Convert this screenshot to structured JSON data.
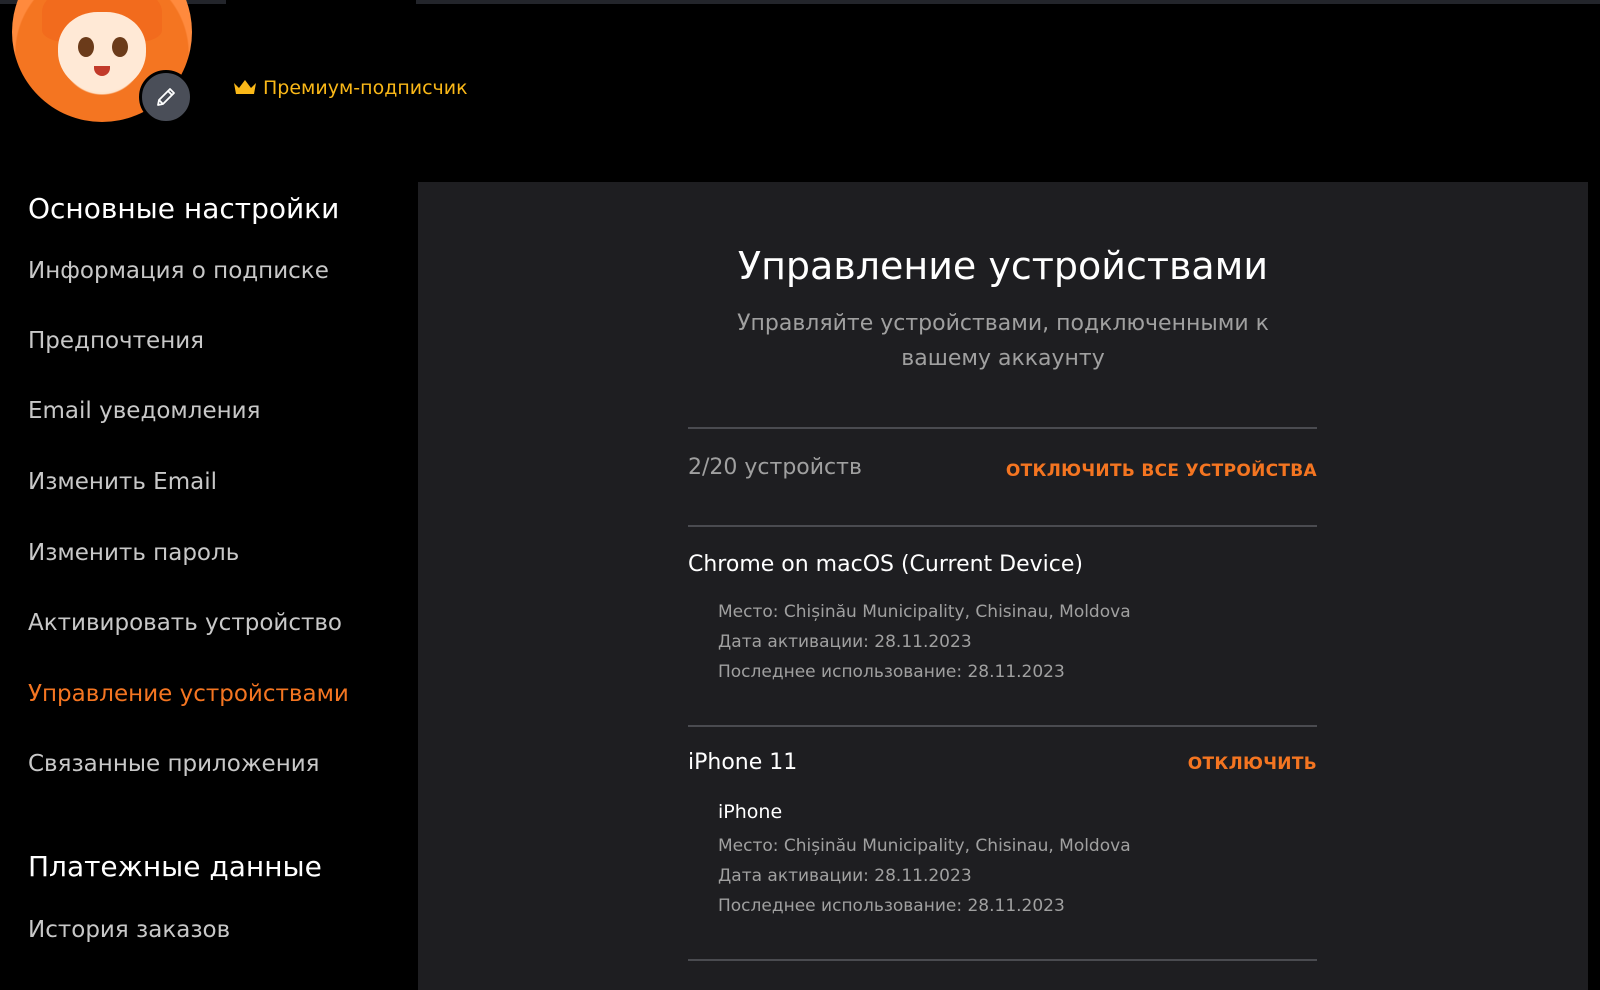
{
  "header": {
    "premium_label": "Премиум-подписчик",
    "premium_color": "#fab818"
  },
  "sidebar": {
    "sections": [
      {
        "heading": "Основные настройки",
        "items": [
          {
            "label": "Информация о подписке",
            "active": false
          },
          {
            "label": "Предпочтения",
            "active": false
          },
          {
            "label": "Email уведомления",
            "active": false
          },
          {
            "label": "Изменить Email",
            "active": false
          },
          {
            "label": "Изменить пароль",
            "active": false
          },
          {
            "label": "Активировать устройство",
            "active": false
          },
          {
            "label": "Управление устройствами",
            "active": true
          },
          {
            "label": "Связанные приложения",
            "active": false
          }
        ]
      },
      {
        "heading": "Платежные данные",
        "items": [
          {
            "label": "История заказов",
            "active": false
          }
        ]
      }
    ]
  },
  "main": {
    "title": "Управление устройствами",
    "subtitle": "Управляйте устройствами, подключенными к вашему аккаунту",
    "device_count": "2/20 устройств",
    "disconnect_all_label": "ОТКЛЮЧИТЬ ВСЕ УСТРОЙСТВА",
    "devices": [
      {
        "name": "Chrome on macOS (Current Device)",
        "type": "",
        "location": "Место: Chișinău Municipality, Chisinau, Moldova",
        "activated": "Дата активации: 28.11.2023",
        "last_used": "Последнее использование: 28.11.2023",
        "action_label": ""
      },
      {
        "name": "iPhone 11",
        "type": "iPhone",
        "location": "Место: Chișinău Municipality, Chisinau, Moldova",
        "activated": "Дата активации: 28.11.2023",
        "last_used": "Последнее использование: 28.11.2023",
        "action_label": "ОТКЛЮЧИТЬ"
      }
    ]
  },
  "colors": {
    "accent": "#f47521",
    "background": "#000000",
    "panel": "#1e1e21"
  }
}
